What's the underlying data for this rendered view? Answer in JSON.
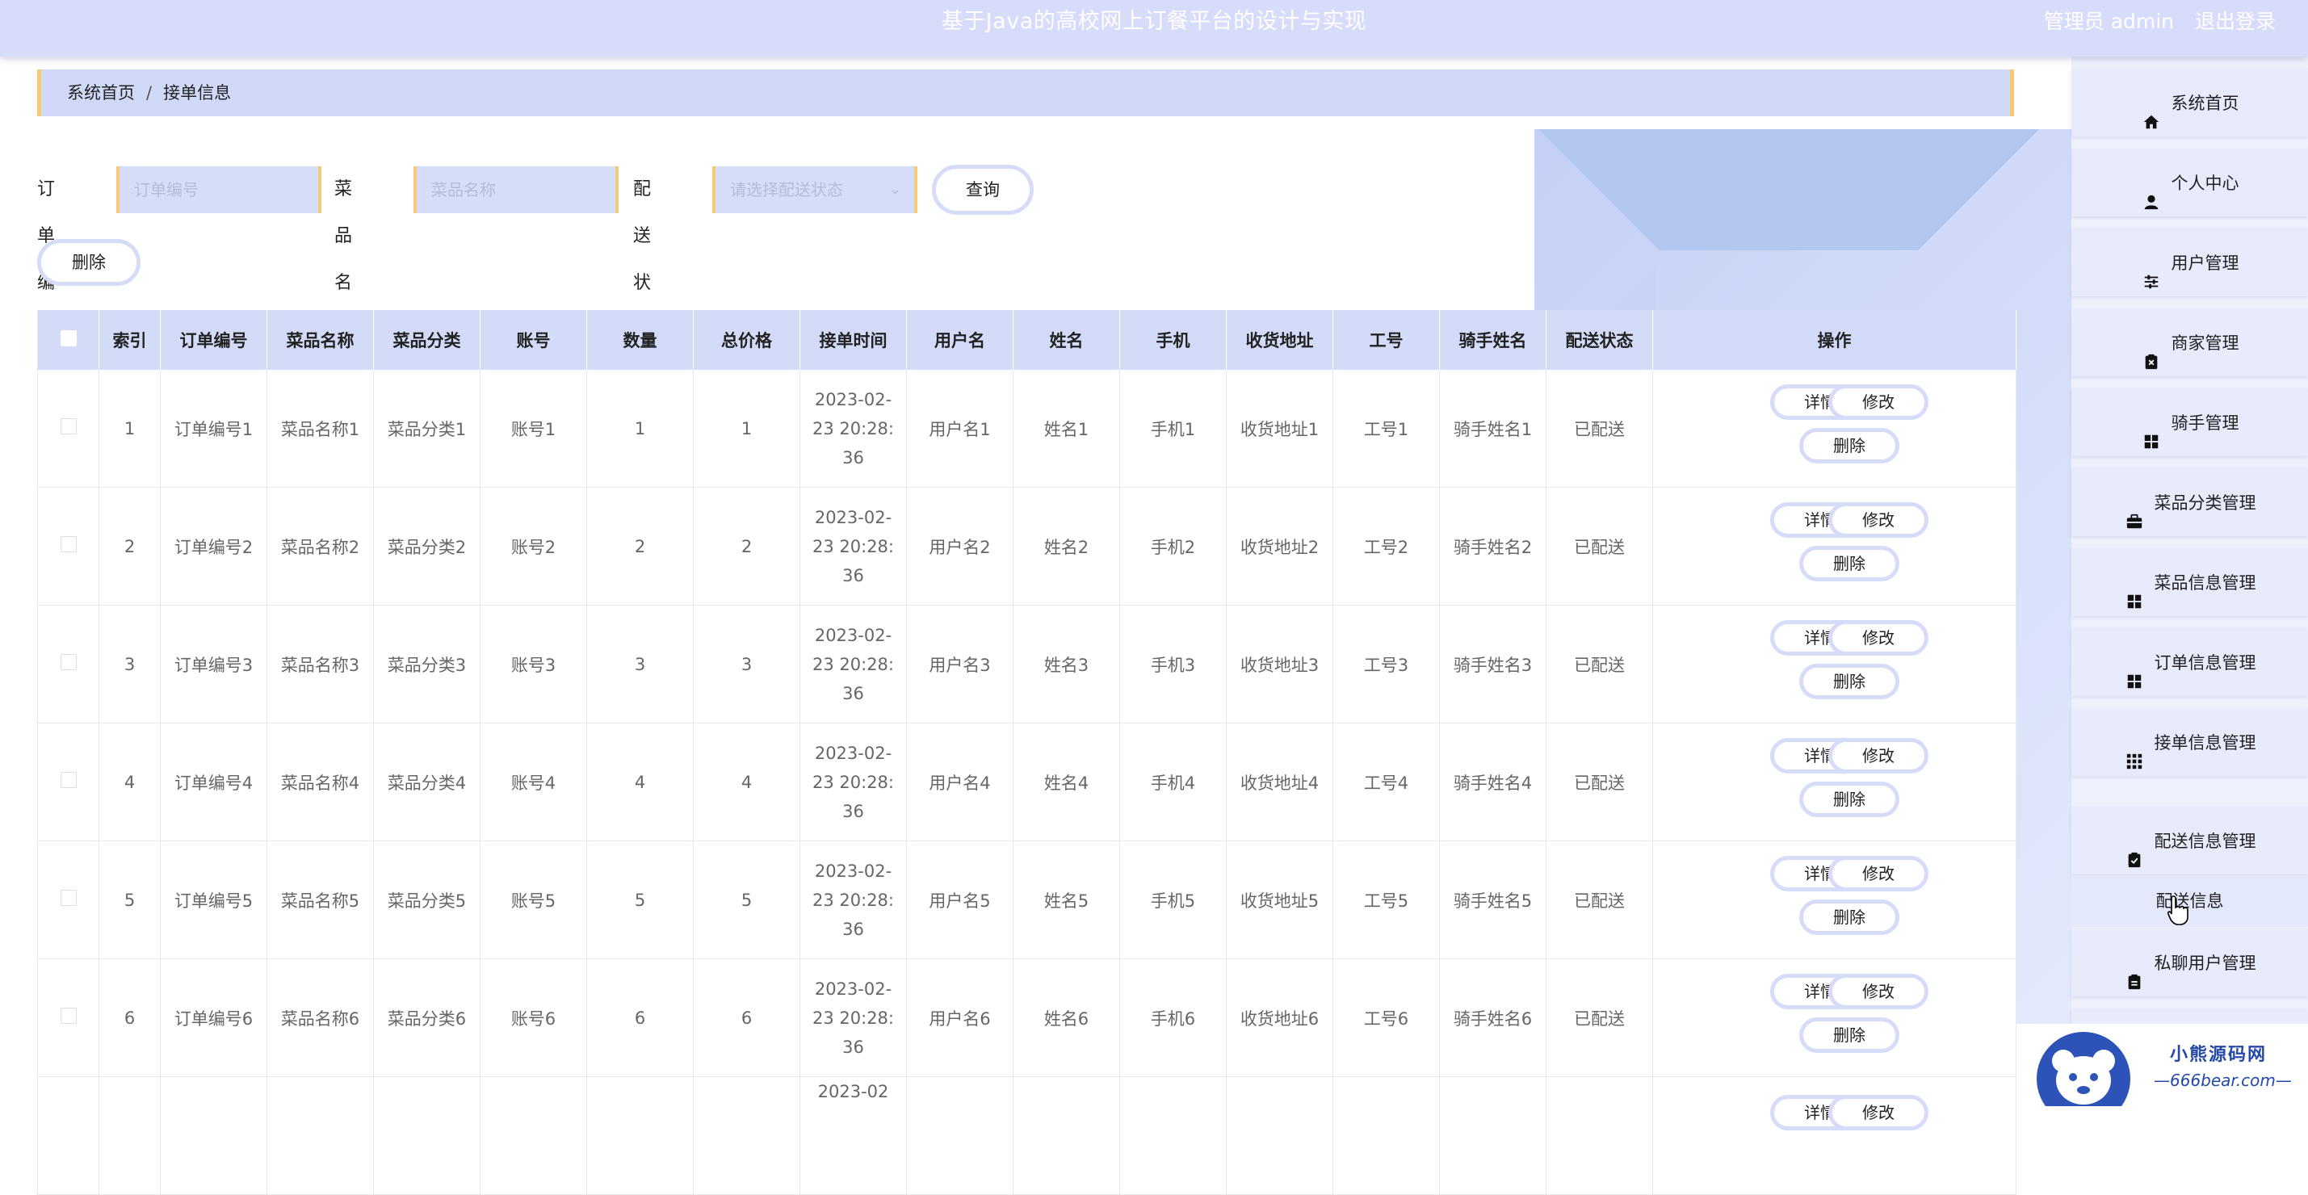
{
  "header": {
    "title": "基于Java的高校网上订餐平台的设计与实现",
    "user": "管理员 admin",
    "logout": "退出登录"
  },
  "breadcrumb": {
    "home": "系统首页",
    "separator": "/",
    "current": "接单信息"
  },
  "search": {
    "order_no_label": "订单编号",
    "order_no_placeholder": "订单编号",
    "dish_name_label": "菜品名称",
    "dish_name_placeholder": "菜品名称",
    "status_label": "配送状态",
    "status_placeholder": "请选择配送状态",
    "query_button": "查询",
    "delete_button": "删除"
  },
  "table": {
    "headers": [
      "索引",
      "订单编号",
      "菜品名称",
      "菜品分类",
      "账号",
      "数量",
      "总价格",
      "接单时间",
      "用户名",
      "姓名",
      "手机",
      "收货地址",
      "工号",
      "骑手姓名",
      "配送状态",
      "操作"
    ],
    "buttons": {
      "detail": "详情",
      "edit": "修改",
      "delete": "删除"
    },
    "rows": [
      {
        "index": "1",
        "order_no": "订单编号1",
        "dish": "菜品名称1",
        "category": "菜品分类1",
        "account": "账号1",
        "qty": "1",
        "total": "1",
        "time_l1": "2023-02-",
        "time_l2": "23 20:28:",
        "time_l3": "36",
        "username": "用户名1",
        "name": "姓名1",
        "phone": "手机1",
        "address": "收货地址1",
        "emp_no": "工号1",
        "rider": "骑手姓名1",
        "status": "已配送"
      },
      {
        "index": "2",
        "order_no": "订单编号2",
        "dish": "菜品名称2",
        "category": "菜品分类2",
        "account": "账号2",
        "qty": "2",
        "total": "2",
        "time_l1": "2023-02-",
        "time_l2": "23 20:28:",
        "time_l3": "36",
        "username": "用户名2",
        "name": "姓名2",
        "phone": "手机2",
        "address": "收货地址2",
        "emp_no": "工号2",
        "rider": "骑手姓名2",
        "status": "已配送"
      },
      {
        "index": "3",
        "order_no": "订单编号3",
        "dish": "菜品名称3",
        "category": "菜品分类3",
        "account": "账号3",
        "qty": "3",
        "total": "3",
        "time_l1": "2023-02-",
        "time_l2": "23 20:28:",
        "time_l3": "36",
        "username": "用户名3",
        "name": "姓名3",
        "phone": "手机3",
        "address": "收货地址3",
        "emp_no": "工号3",
        "rider": "骑手姓名3",
        "status": "已配送"
      },
      {
        "index": "4",
        "order_no": "订单编号4",
        "dish": "菜品名称4",
        "category": "菜品分类4",
        "account": "账号4",
        "qty": "4",
        "total": "4",
        "time_l1": "2023-02-",
        "time_l2": "23 20:28:",
        "time_l3": "36",
        "username": "用户名4",
        "name": "姓名4",
        "phone": "手机4",
        "address": "收货地址4",
        "emp_no": "工号4",
        "rider": "骑手姓名4",
        "status": "已配送"
      },
      {
        "index": "5",
        "order_no": "订单编号5",
        "dish": "菜品名称5",
        "category": "菜品分类5",
        "account": "账号5",
        "qty": "5",
        "total": "5",
        "time_l1": "2023-02-",
        "time_l2": "23 20:28:",
        "time_l3": "36",
        "username": "用户名5",
        "name": "姓名5",
        "phone": "手机5",
        "address": "收货地址5",
        "emp_no": "工号5",
        "rider": "骑手姓名5",
        "status": "已配送"
      },
      {
        "index": "6",
        "order_no": "订单编号6",
        "dish": "菜品名称6",
        "category": "菜品分类6",
        "account": "账号6",
        "qty": "6",
        "total": "6",
        "time_l1": "2023-02-",
        "time_l2": "23 20:28:",
        "time_l3": "36",
        "username": "用户名6",
        "name": "姓名6",
        "phone": "手机6",
        "address": "收货地址6",
        "emp_no": "工号6",
        "rider": "骑手姓名6",
        "status": "已配送"
      },
      {
        "index": "",
        "order_no": "",
        "dish": "",
        "category": "",
        "account": "",
        "qty": "",
        "total": "",
        "time_l1": "2023-02",
        "time_l2": "",
        "time_l3": "",
        "username": "",
        "name": "",
        "phone": "",
        "address": "",
        "emp_no": "",
        "rider": "",
        "status": ""
      }
    ]
  },
  "sidebar": {
    "items": [
      {
        "label": "系统首页",
        "icon": "home-icon"
      },
      {
        "label": "个人中心",
        "icon": "user-icon"
      },
      {
        "label": "用户管理",
        "icon": "sliders-icon"
      },
      {
        "label": "商家管理",
        "icon": "clipboard-x-icon"
      },
      {
        "label": "骑手管理",
        "icon": "grid-icon"
      },
      {
        "label": "菜品分类管理",
        "icon": "briefcase-icon"
      },
      {
        "label": "菜品信息管理",
        "icon": "grid-icon"
      },
      {
        "label": "订单信息管理",
        "icon": "grid-icon"
      },
      {
        "label": "接单信息管理",
        "icon": "apps-icon"
      },
      {
        "label": "配送信息管理",
        "icon": "clipboard-check-icon"
      },
      {
        "label": "私聊用户管理",
        "icon": "clipboard-icon"
      }
    ],
    "sub_item": "配送信息"
  },
  "watermark": {
    "line1": "小熊源码网",
    "line2": "—666bear.com—"
  },
  "colors": {
    "header_bg": "#d6dcfa",
    "accent": "#f6c972",
    "table_head_bg": "#d3dbf8",
    "sidebar_bg": "#e7ebfb"
  }
}
